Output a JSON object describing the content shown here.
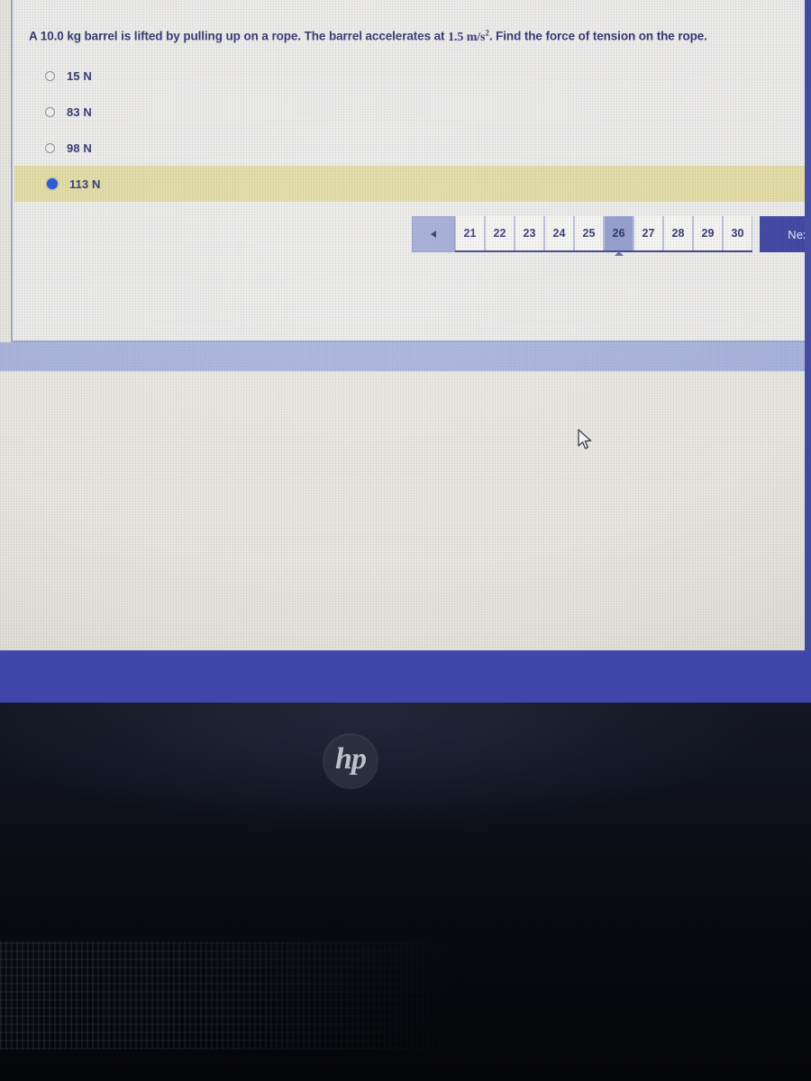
{
  "quiz": {
    "question": {
      "prefix": "A 10.0 kg barrel is lifted by pulling up on a rope. The barrel accelerates at ",
      "value": "1.5 m/s",
      "exponent": "2",
      "suffix": ". Find the force of tension on the rope."
    },
    "options": [
      {
        "label": "15 N",
        "selected": false
      },
      {
        "label": "83 N",
        "selected": false
      },
      {
        "label": "98 N",
        "selected": false
      },
      {
        "label": "113 N",
        "selected": true
      }
    ],
    "pagination": {
      "prev_label": "",
      "pages": [
        "21",
        "22",
        "23",
        "24",
        "25",
        "26",
        "27",
        "28",
        "29",
        "30"
      ],
      "active_page": "26",
      "next_label": "Next"
    }
  },
  "hardware": {
    "brand_logo": "hp"
  },
  "colors": {
    "accent_blue": "#3a41a0",
    "selected_highlight": "#e3dca1",
    "radio_selected": "#1d4fd8",
    "text_navy": "#2b2f6b",
    "band_light_blue": "#a9b2dc",
    "footer_blue": "#3f47ab",
    "screen_background": "#e9e8df"
  }
}
